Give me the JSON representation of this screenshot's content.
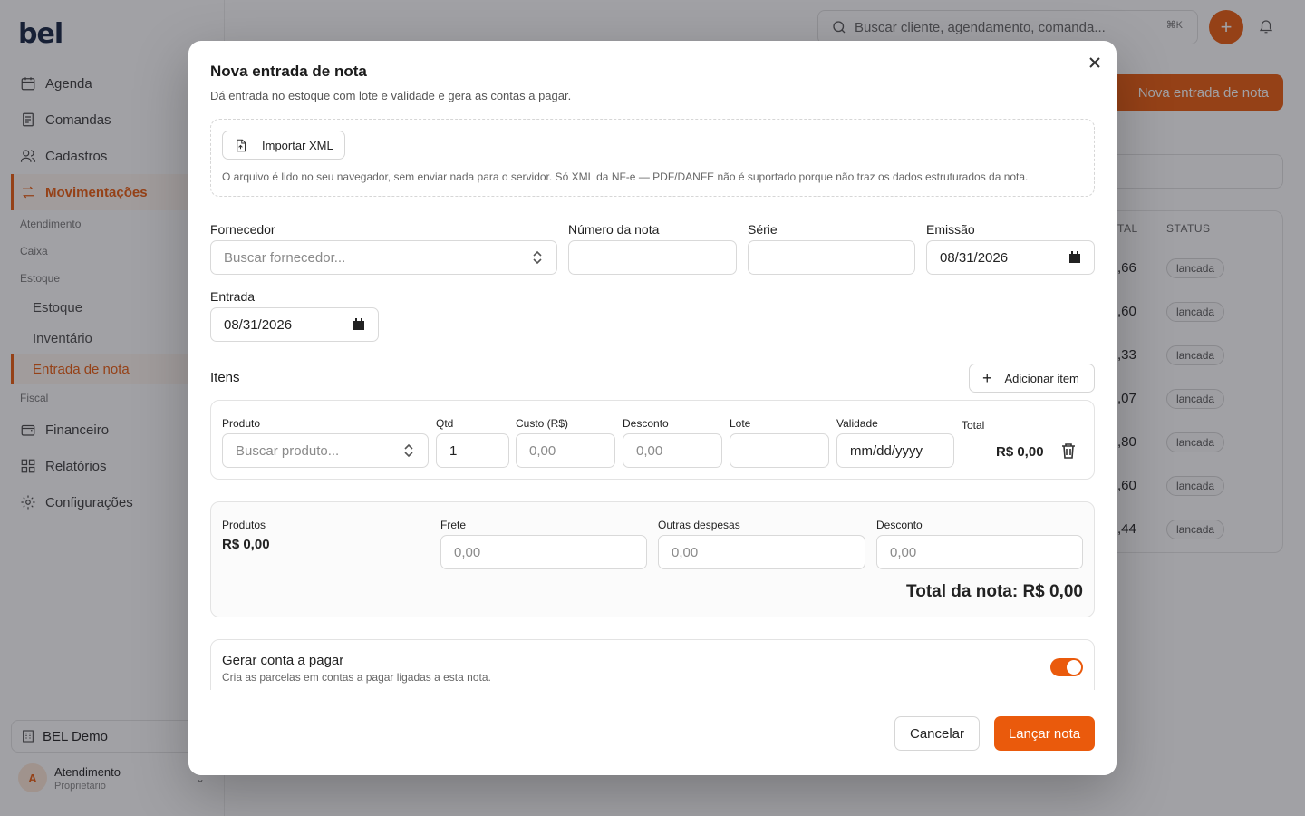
{
  "app": {
    "logo_text": "bel",
    "brand_color": "#ea5a0c",
    "search_placeholder": "Buscar cliente, agendamento, comanda...",
    "search_shortcut": "⌘K",
    "header_button": "Nova entrada de nota"
  },
  "sidebar": {
    "items": [
      {
        "label": "Agenda",
        "icon": "calendar-icon"
      },
      {
        "label": "Comandas",
        "icon": "receipt-icon"
      },
      {
        "label": "Cadastros",
        "icon": "users-icon"
      },
      {
        "label": "Movimentações",
        "icon": "arrows-icon"
      }
    ],
    "sections": [
      "Atendimento",
      "Caixa",
      "Estoque",
      "Fiscal"
    ],
    "sub_items": [
      "Estoque",
      "Inventário",
      "Entrada de nota"
    ],
    "bottom_items": [
      {
        "label": "Financeiro",
        "icon": "wallet-icon"
      },
      {
        "label": "Relatórios",
        "icon": "grid-icon"
      },
      {
        "label": "Configurações",
        "icon": "gear-icon"
      }
    ],
    "org": "BEL Demo",
    "user": {
      "initial": "A",
      "name": "Atendimento",
      "role": "Proprietario"
    }
  },
  "table": {
    "headers": [
      "TAL",
      "STATUS"
    ],
    "rows": [
      {
        "total": ",66",
        "status": "lancada"
      },
      {
        "total": ",60",
        "status": "lancada"
      },
      {
        "total": ",33",
        "status": "lancada"
      },
      {
        "total": ",07",
        "status": "lancada"
      },
      {
        "total": ",80",
        "status": "lancada"
      },
      {
        "total": ",60",
        "status": "lancada"
      },
      {
        "total": ",44",
        "status": "lancada"
      }
    ]
  },
  "modal": {
    "title": "Nova entrada de nota",
    "subtitle": "Dá entrada no estoque com lote e validade e gera as contas a pagar.",
    "import_button": "Importar XML",
    "import_note": "O arquivo é lido no seu navegador, sem enviar nada para o servidor. Só XML da NF-e — PDF/DANFE não é suportado porque não traz os dados estruturados da nota.",
    "fields": {
      "fornecedor_label": "Fornecedor",
      "fornecedor_placeholder": "Buscar fornecedor...",
      "numero_label": "Número da nota",
      "numero_value": "",
      "serie_label": "Série",
      "serie_value": "",
      "emissao_label": "Emissão",
      "emissao_value": "08/31/2026",
      "entrada_label": "Entrada",
      "entrada_value": "08/31/2026"
    },
    "items_title": "Itens",
    "add_item_button": "Adicionar item",
    "item": {
      "produto_label": "Produto",
      "produto_placeholder": "Buscar produto...",
      "qtd_label": "Qtd",
      "qtd_value": "1",
      "custo_label": "Custo (R$)",
      "custo_placeholder": "0,00",
      "desconto_label": "Desconto",
      "desconto_placeholder": "0,00",
      "lote_label": "Lote",
      "lote_value": "",
      "validade_label": "Validade",
      "validade_placeholder": "mm/dd/yyyy",
      "total_label": "Total",
      "total_value": "R$ 0,00"
    },
    "totals": {
      "produtos_label": "Produtos",
      "produtos_value": "R$ 0,00",
      "frete_label": "Frete",
      "frete_placeholder": "0,00",
      "outras_label": "Outras despesas",
      "outras_placeholder": "0,00",
      "desconto_label": "Desconto",
      "desconto_placeholder": "0,00",
      "total_nota": "Total da nota: R$ 0,00"
    },
    "payable": {
      "title": "Gerar conta a pagar",
      "description": "Cria as parcelas em contas a pagar ligadas a esta nota.",
      "enabled": true
    },
    "footer": {
      "cancel": "Cancelar",
      "submit": "Lançar nota"
    }
  }
}
